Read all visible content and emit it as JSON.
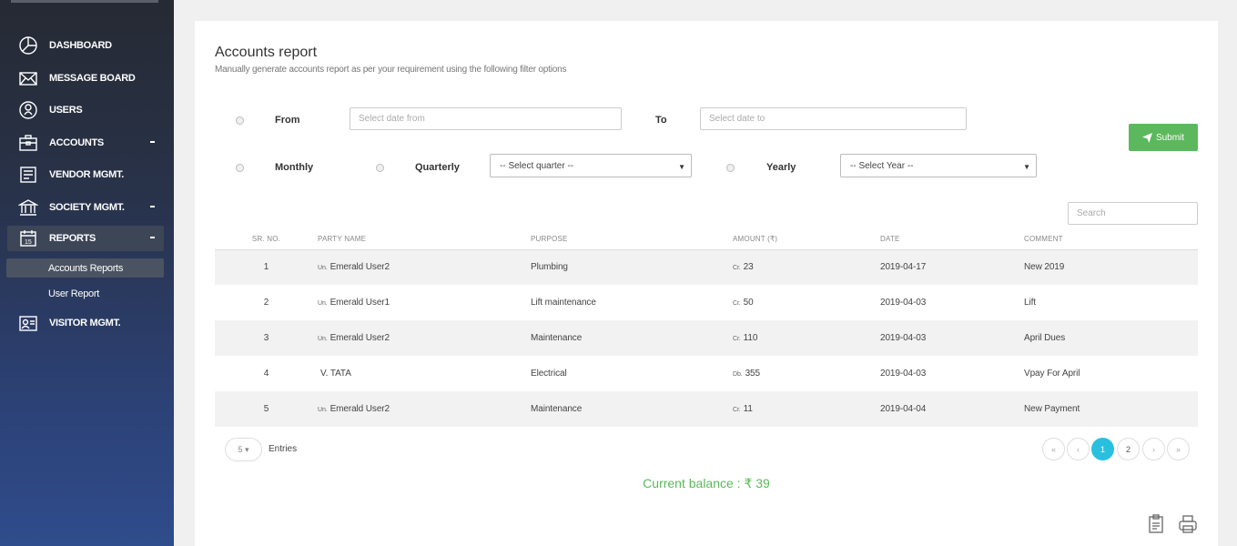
{
  "sidebar": {
    "items": [
      {
        "label": "DASHBOARD",
        "icon": "pie-chart-icon"
      },
      {
        "label": "MESSAGE BOARD",
        "icon": "envelope-icon"
      },
      {
        "label": "USERS",
        "icon": "user-icon"
      },
      {
        "label": "ACCOUNTS",
        "icon": "briefcase-icon"
      },
      {
        "label": "VENDOR MGMT.",
        "icon": "vendor-icon"
      },
      {
        "label": "SOCIETY MGMT.",
        "icon": "bank-icon"
      },
      {
        "label": "REPORTS",
        "icon": "calendar-icon"
      },
      {
        "label": "VISITOR MGMT.",
        "icon": "visitor-icon"
      }
    ],
    "sub_items": [
      {
        "label": "Accounts Reports"
      },
      {
        "label": "User Report"
      }
    ]
  },
  "report": {
    "title": "Accounts report",
    "subtitle": "Manually generate accounts report as per your requirement using the following filter options"
  },
  "filters": {
    "from_label": "From",
    "from_placeholder": "Select date from",
    "to_label": "To",
    "to_placeholder": "Select date to",
    "monthly_label": "Monthly",
    "quarterly_label": "Quarterly",
    "quarter_select": "-- Select quarter --",
    "yearly_label": "Yearly",
    "year_select": "-- Select Year --",
    "submit_label": "Submit"
  },
  "search": {
    "placeholder": "Search"
  },
  "table": {
    "headers": [
      "SR. NO.",
      "PARTY NAME",
      "PURPOSE",
      "AMOUNT (₹)",
      "DATE",
      "COMMENT"
    ],
    "rows": [
      {
        "sr": "1",
        "party_prefix": "Un.",
        "party": "Emerald User2",
        "purpose": "Plumbing",
        "amount_prefix": "Cr.",
        "amount": "23",
        "date": "2019-04-17",
        "comment": "New 2019"
      },
      {
        "sr": "2",
        "party_prefix": "Un.",
        "party": "Emerald User1",
        "purpose": "Lift maintenance",
        "amount_prefix": "Cr.",
        "amount": "50",
        "date": "2019-04-03",
        "comment": "Lift"
      },
      {
        "sr": "3",
        "party_prefix": "Un.",
        "party": "Emerald User2",
        "purpose": "Maintenance",
        "amount_prefix": "Cr.",
        "amount": "110",
        "date": "2019-04-03",
        "comment": "April Dues"
      },
      {
        "sr": "4",
        "party_prefix": "",
        "party": "V. TATA",
        "purpose": "Electrical",
        "amount_prefix": "Db.",
        "amount": "355",
        "date": "2019-04-03",
        "comment": "Vpay For April"
      },
      {
        "sr": "5",
        "party_prefix": "Un.",
        "party": "Emerald User2",
        "purpose": "Maintenance",
        "amount_prefix": "Cr.",
        "amount": "11",
        "date": "2019-04-04",
        "comment": "New Payment"
      }
    ]
  },
  "pagination": {
    "entries_value": "5 ▾",
    "entries_label": "Entries",
    "first": "«",
    "prev": "‹",
    "page1": "1",
    "page2": "2",
    "next": "›",
    "last": "»"
  },
  "balance": {
    "text": "Current balance : ₹ 39"
  },
  "colors": {
    "accent_green": "#5cb85c",
    "active_page": "#29c0e0",
    "sidebar_top": "#262a33",
    "sidebar_bottom": "#2f4c8c"
  }
}
